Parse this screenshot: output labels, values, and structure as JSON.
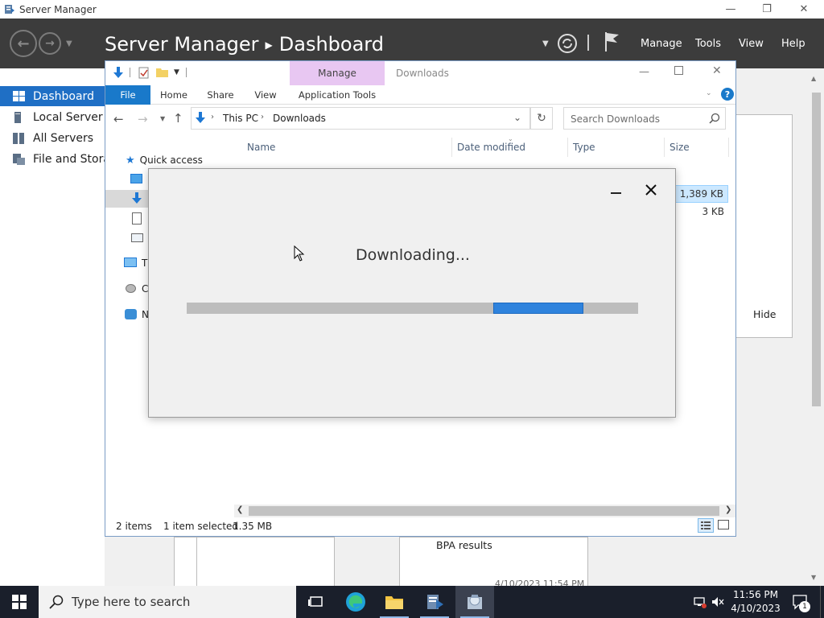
{
  "server_manager": {
    "window_title": "Server Manager",
    "breadcrumb_root": "Server Manager",
    "breadcrumb_page": "Dashboard",
    "menu": [
      "Manage",
      "Tools",
      "View",
      "Help"
    ],
    "nav": [
      "Dashboard",
      "Local Server",
      "All Servers",
      "File and Storag"
    ],
    "hide_label": "Hide",
    "bpa_label": "BPA results",
    "timestamp_partial": "4/10/2023 11:54 PM"
  },
  "explorer": {
    "context_tab": "Manage",
    "window_title": "Downloads",
    "ribbon_tabs": [
      "File",
      "Home",
      "Share",
      "View",
      "Application Tools"
    ],
    "address": {
      "root": "This PC",
      "current": "Downloads"
    },
    "search_placeholder": "Search Downloads",
    "columns": [
      "Name",
      "Date modified",
      "Type",
      "Size"
    ],
    "tree": {
      "quick_access": "Quick access",
      "this_pc_partial": "Th",
      "drive_partial": "C",
      "network_partial": "N"
    },
    "sizes": [
      "1,389 KB",
      "3 KB"
    ],
    "status": {
      "items": "2 items",
      "selected": "1 item selected",
      "size": "1.35 MB"
    }
  },
  "dialog": {
    "text": "Downloading...",
    "progress_fraction": 0.68
  },
  "taskbar": {
    "search_placeholder": "Type here to search",
    "time": "11:56 PM",
    "date": "4/10/2023",
    "notification_count": "1"
  },
  "colors": {
    "accent": "#1f6fc5",
    "header_bg": "#3c3c3c",
    "context_tab": "#e8c7f2",
    "progress": "#2f83dd",
    "taskbar": "#1a1f2b"
  }
}
